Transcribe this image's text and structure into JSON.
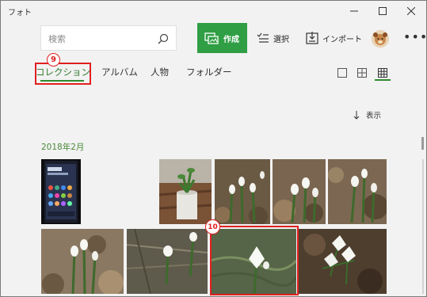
{
  "window": {
    "title": "フォト"
  },
  "search": {
    "placeholder": "検索"
  },
  "toolbar": {
    "create_label": "作成",
    "select_label": "選択",
    "import_label": "インポート",
    "more_label": "•••"
  },
  "tabs": [
    {
      "label": "コレクション",
      "active": true
    },
    {
      "label": "アルバム",
      "active": false
    },
    {
      "label": "人物",
      "active": false
    },
    {
      "label": "フォルダー",
      "active": false
    }
  ],
  "annotations": {
    "badge_9": "9",
    "badge_10": "10"
  },
  "sort": {
    "label": "表示"
  },
  "section": {
    "date_heading": "2018年2月"
  },
  "colors": {
    "accent": "#2f9e44",
    "highlight": "#e02020"
  },
  "icons": [
    "minimize-icon",
    "maximize-icon",
    "close-icon",
    "search-icon",
    "create-icon",
    "select-icon",
    "import-icon",
    "avatar",
    "more-icon",
    "view-large-icon",
    "view-medium-icon",
    "view-small-icon",
    "sort-arrow-icon"
  ]
}
